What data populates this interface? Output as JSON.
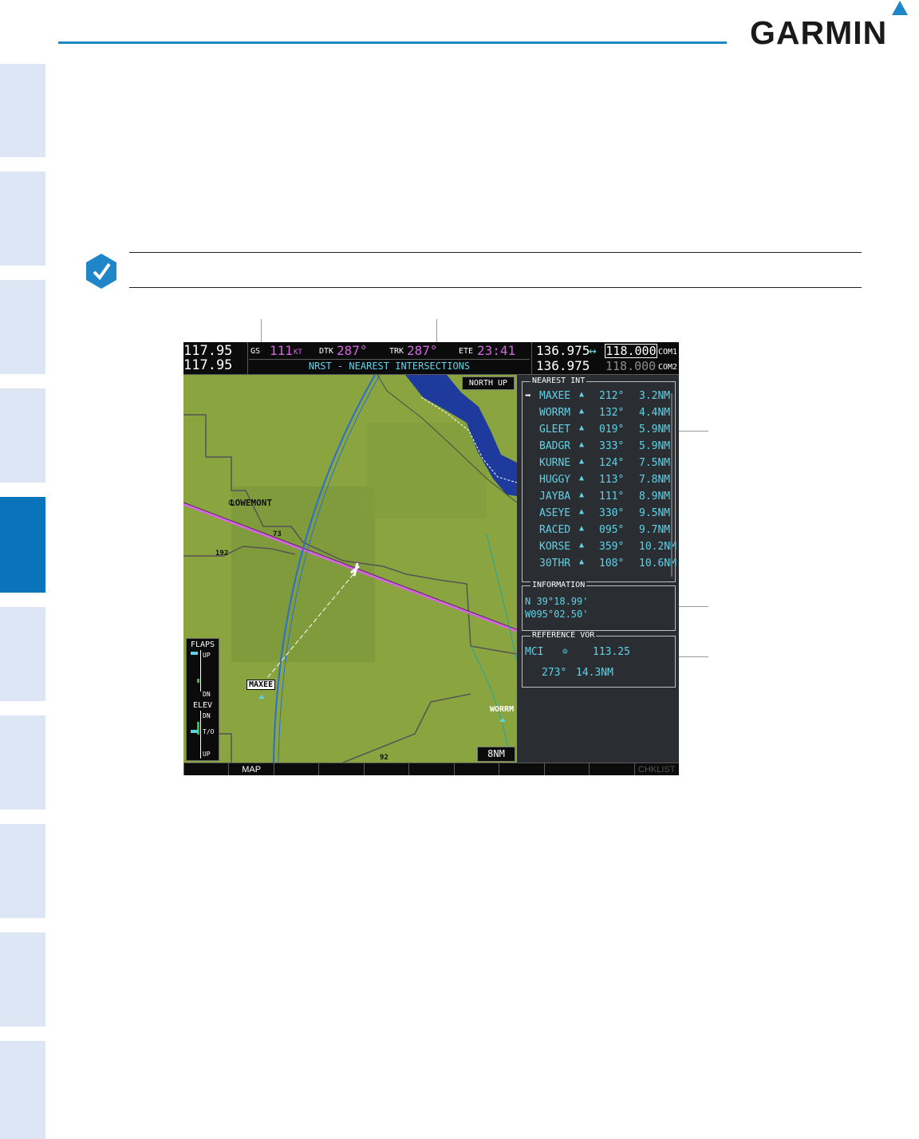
{
  "brand": {
    "logo_text": "GARMIN",
    "accent_color": "#1f86c8"
  },
  "side_tabs": {
    "active_index": 4,
    "count": 10
  },
  "mfd": {
    "nav": {
      "nav1_freq": "117.95",
      "nav2_freq": "117.95"
    },
    "fields": {
      "gs_label": "GS",
      "gs_value": "111",
      "gs_unit": "KT",
      "dtk_label": "DTK",
      "dtk_value": "287°",
      "trk_label": "TRK",
      "trk_value": "287°",
      "ete_label": "ETE",
      "ete_value": "23:41"
    },
    "page_title": "NRST - NEAREST INTERSECTIONS",
    "com": {
      "com1_standby": "136.975",
      "com1_active": "118.000",
      "com1_label": "COM1",
      "com2_standby": "136.975",
      "com2_active": "118.000",
      "com2_label": "COM2",
      "transfer_arrow": "↔"
    },
    "map": {
      "orientation": "NORTH UP",
      "range": "8NM",
      "town": "LOWEMONT",
      "route_192": "192",
      "route_73": "73",
      "route_92": "92",
      "waypoint_selected": "MAXEE",
      "waypoint_other": "WORRM",
      "map_color": "#8aa43f",
      "water_color": "#1e3a9c"
    },
    "flaps": {
      "title": "FLAPS",
      "up": "UP",
      "dn": "DN",
      "elev_title": "ELEV",
      "elev_dn": "DN",
      "elev_to": "T/O",
      "elev_up": "UP"
    },
    "nearest": {
      "title": "NEAREST INT",
      "rows": [
        {
          "pointer": "➡",
          "id": "MAXEE",
          "brg": "212°",
          "dis": "3.2NM"
        },
        {
          "pointer": "",
          "id": "WORRM",
          "brg": "132°",
          "dis": "4.4NM"
        },
        {
          "pointer": "",
          "id": "GLEET",
          "brg": "019°",
          "dis": "5.9NM"
        },
        {
          "pointer": "",
          "id": "BADGR",
          "brg": "333°",
          "dis": "5.9NM"
        },
        {
          "pointer": "",
          "id": "KURNE",
          "brg": "124°",
          "dis": "7.5NM"
        },
        {
          "pointer": "",
          "id": "HUGGY",
          "brg": "113°",
          "dis": "7.8NM"
        },
        {
          "pointer": "",
          "id": "JAYBA",
          "brg": "111°",
          "dis": "8.9NM"
        },
        {
          "pointer": "",
          "id": "ASEYE",
          "brg": "330°",
          "dis": "9.5NM"
        },
        {
          "pointer": "",
          "id": "RACED",
          "brg": "095°",
          "dis": "9.7NM"
        },
        {
          "pointer": "",
          "id": "KORSE",
          "brg": "359°",
          "dis": "10.2NM"
        },
        {
          "pointer": "",
          "id": "30THR",
          "brg": "108°",
          "dis": "10.6NM"
        }
      ]
    },
    "information": {
      "title": "INFORMATION",
      "lat": "N 39°18.99'",
      "lon": "W095°02.50'"
    },
    "reference_vor": {
      "title": "REFERENCE VOR",
      "id": "MCI",
      "symbol": "⊙",
      "freq": "113.25",
      "brg": "273°",
      "dis": "14.3NM"
    },
    "softkeys": [
      "",
      "MAP",
      "",
      "",
      "",
      "",
      "",
      "",
      "",
      "",
      "CHKLIST"
    ]
  }
}
